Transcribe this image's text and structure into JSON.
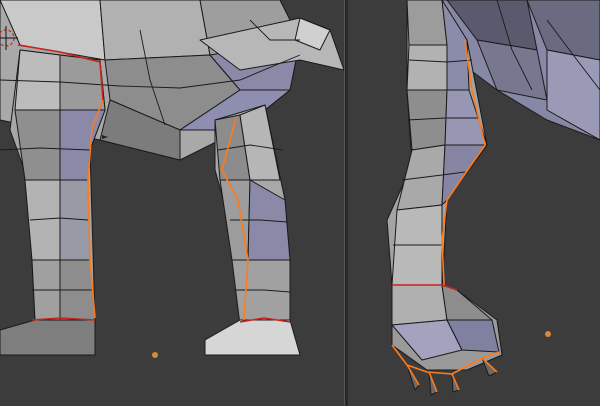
{
  "editor": {
    "mode": "edit-mode-uv-seams",
    "panes": [
      "3d-viewport-left",
      "3d-viewport-right"
    ]
  },
  "colors": {
    "background": "#3c3c3c",
    "mesh_light": "#b4b4b4",
    "mesh_mid": "#9c9c9c",
    "mesh_dark": "#7a7a7a",
    "mesh_blue": "#8e8eb0",
    "seam_orange": "#ff7a1a",
    "seam_red": "#c8241c",
    "wire": "#1a1a1a",
    "vertex_dot": "#d98a3a"
  },
  "icons": {
    "cursor": "3d-cursor-icon",
    "pivot_left": "vertex-dot-icon",
    "pivot_right": "vertex-dot-icon"
  }
}
